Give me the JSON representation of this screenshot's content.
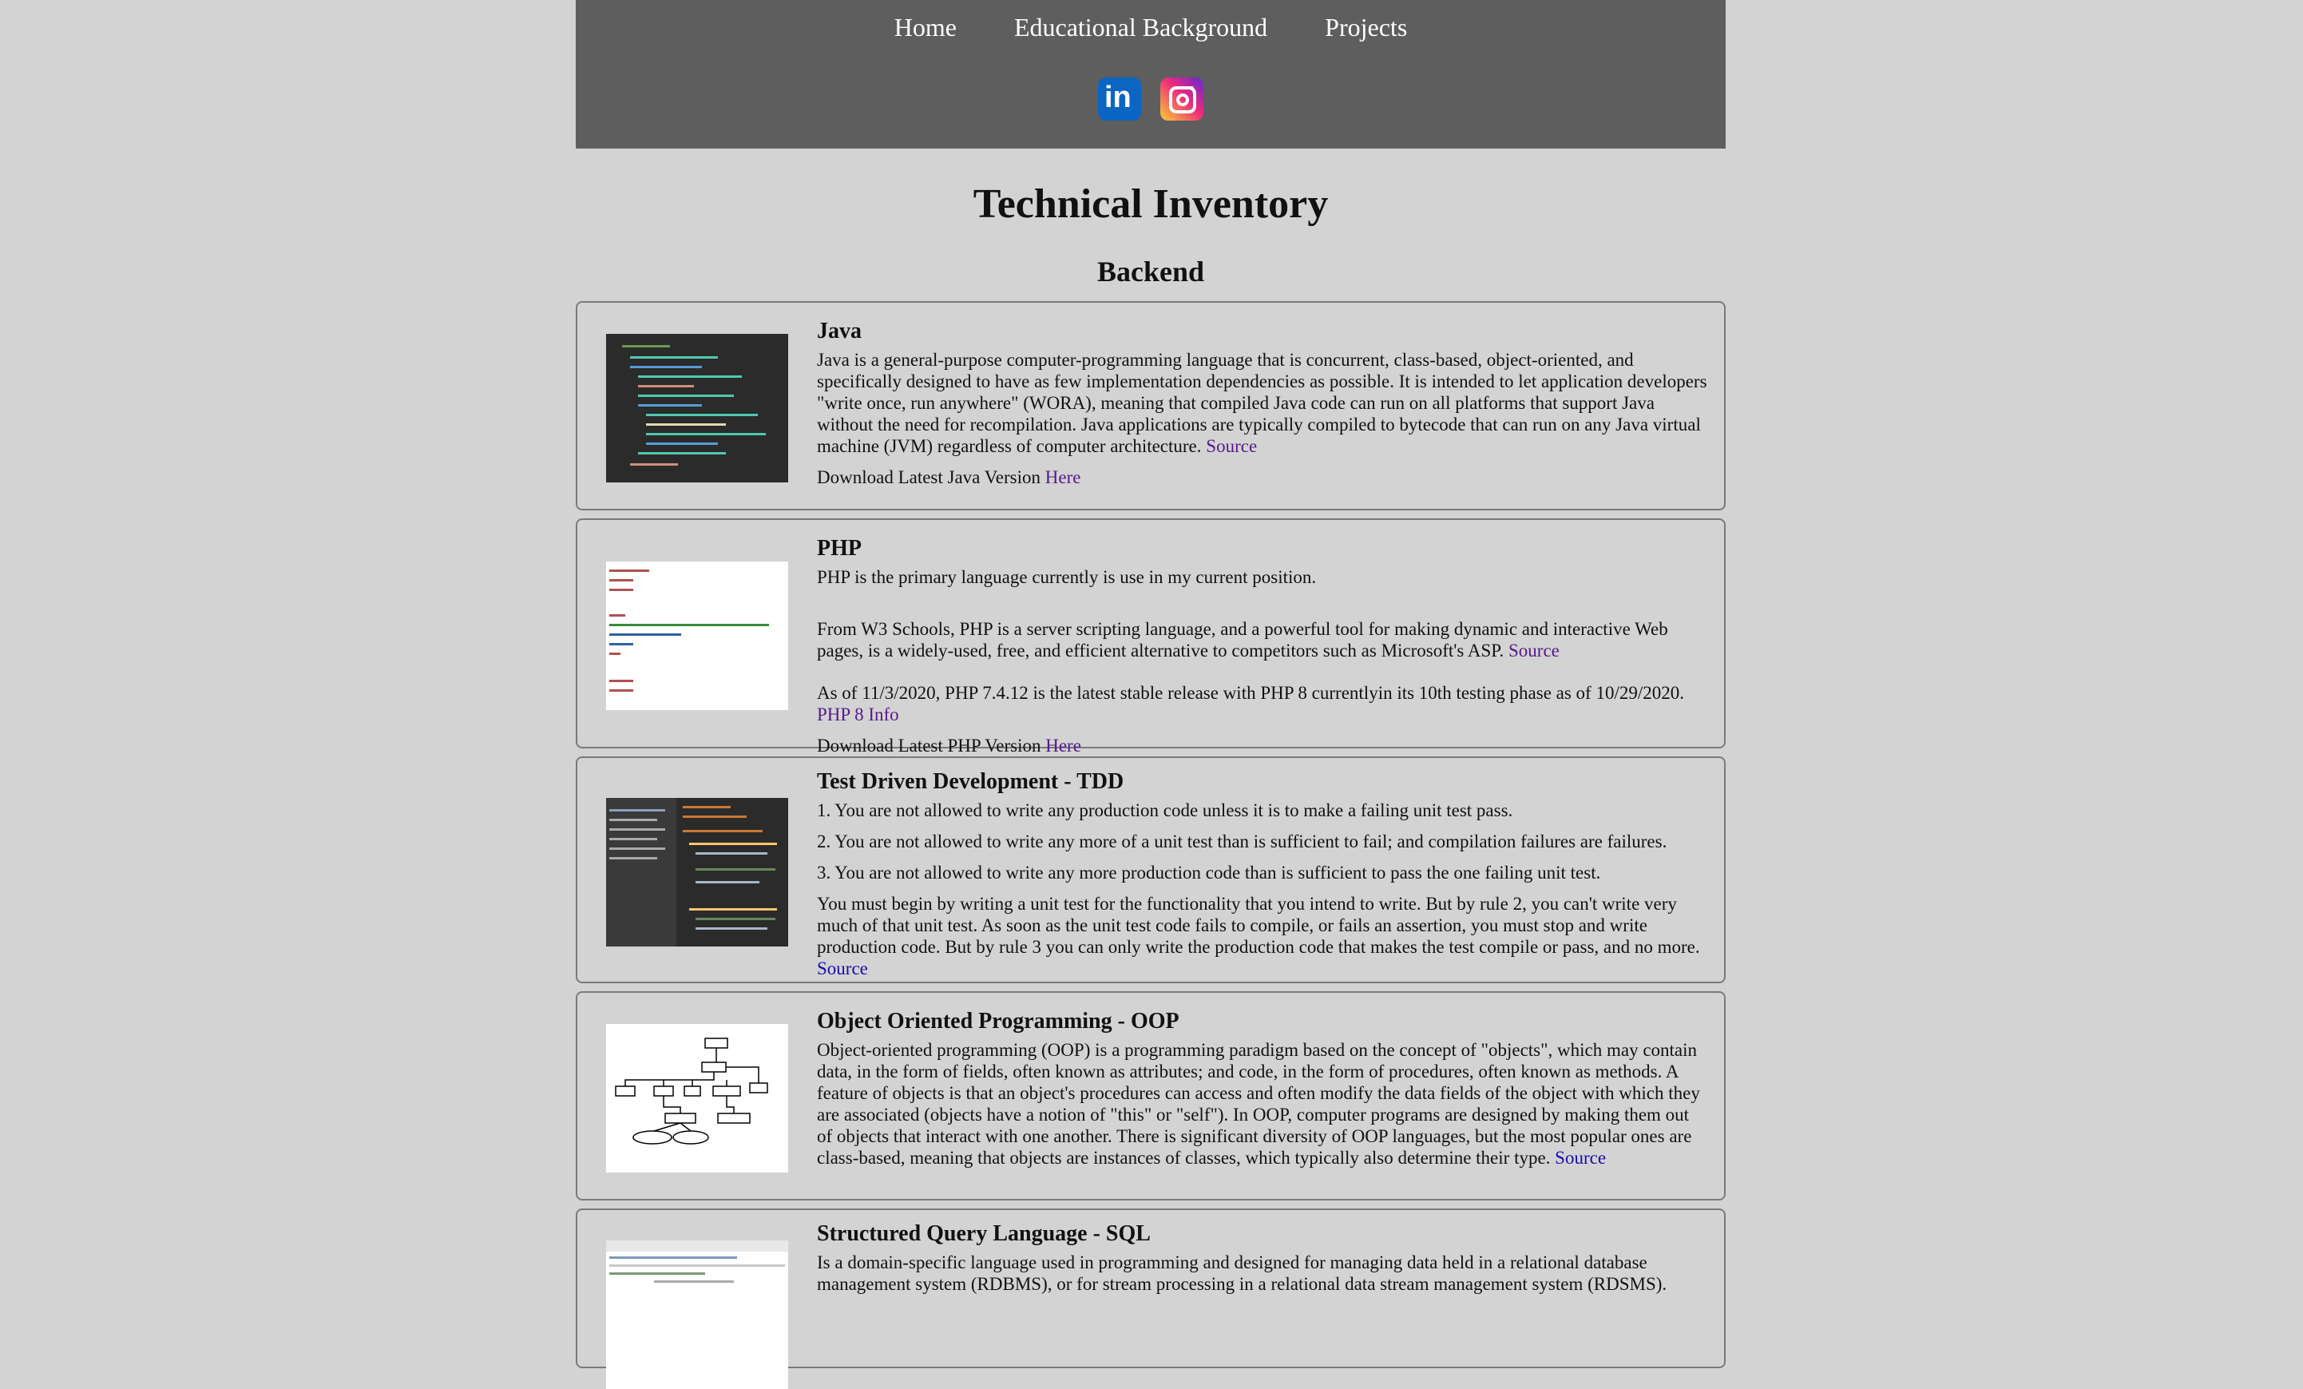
{
  "nav": {
    "links": [
      "Home",
      "Educational Background",
      "Projects"
    ],
    "social": [
      "linkedin-icon",
      "instagram-icon"
    ]
  },
  "page_title": "Technical Inventory",
  "section_title": "Backend",
  "cards": {
    "java": {
      "title": "Java",
      "body": "Java is a general-purpose computer-programming language that is concurrent, class-based, object-oriented, and specifically designed to have as few implementation dependencies as possible. It is intended to let application developers \"write once, run anywhere\" (WORA), meaning that compiled Java code can run on all platforms that support Java without the need for recompilation. Java applications are typically compiled to bytecode that can run on any Java virtual machine (JVM) regardless of computer architecture.",
      "source": "Source",
      "download": "Download Latest Java Version",
      "here": "Here"
    },
    "php": {
      "title": "PHP",
      "p1": "PHP is the primary language currently is use in my current position.",
      "p2": "From W3 Schools, PHP is a server scripting language, and a powerful tool for making dynamic and interactive Web pages, is a widely-used, free, and efficient alternative to competitors such as Microsoft's ASP.",
      "source": "Source",
      "p3": "As of 11/3/2020, PHP 7.4.12 is the latest stable release with PHP 8 currentlyin its 10th testing phase as of 10/29/2020.",
      "info": "PHP 8 Info",
      "download": "Download Latest PHP Version",
      "here": "Here"
    },
    "tdd": {
      "title": "Test Driven Development - TDD",
      "r1": "1. You are not allowed to write any production code unless it is to make a failing unit test pass.",
      "r2": "2. You are not allowed to write any more of a unit test than is sufficient to fail; and compilation failures are failures.",
      "r3": "3. You are not allowed to write any more production code than is sufficient to pass the one failing unit test.",
      "body": "You must begin by writing a unit test for the functionality that you intend to write. But by rule 2, you can't write very much of that unit test. As soon as the unit test code fails to compile, or fails an assertion, you must stop and write production code. But by rule 3 you can only write the production code that makes the test compile or pass, and no more.",
      "source": "Source"
    },
    "oop": {
      "title": "Object Oriented Programming - OOP",
      "body": "Object-oriented programming (OOP) is a programming paradigm based on the concept of \"objects\", which may contain data, in the form of fields, often known as attributes; and code, in the form of procedures, often known as methods. A feature of objects is that an object's procedures can access and often modify the data fields of the object with which they are associated (objects have a notion of \"this\" or \"self\"). In OOP, computer programs are designed by making them out of objects that interact with one another. There is significant diversity of OOP languages, but the most popular ones are class-based, meaning that objects are instances of classes, which typically also determine their type.",
      "source": "Source"
    },
    "sql": {
      "title": "Structured Query Language - SQL",
      "body": "Is a domain-specific language used in programming and designed for managing data held in a relational database management system (RDBMS), or for stream processing in a relational data stream management system (RDSMS)."
    }
  }
}
